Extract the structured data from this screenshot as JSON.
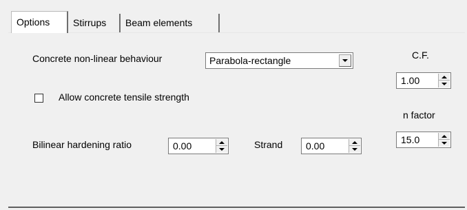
{
  "tabs": [
    {
      "label": "Options",
      "active": true
    },
    {
      "label": "Stirrups",
      "active": false
    },
    {
      "label": "Beam elements",
      "active": false
    }
  ],
  "concrete": {
    "label": "Concrete non-linear behaviour",
    "selected": "Parabola-rectangle"
  },
  "tensile": {
    "label": "Allow concrete tensile strength",
    "checked": false
  },
  "hardening": {
    "label": "Bilinear hardening ratio",
    "value": "0.00"
  },
  "strand": {
    "label": "Strand",
    "value": "0.00"
  },
  "cf": {
    "label": "C.F.",
    "value": "1.00"
  },
  "nfactor": {
    "label": "n factor",
    "value": "15.0"
  }
}
